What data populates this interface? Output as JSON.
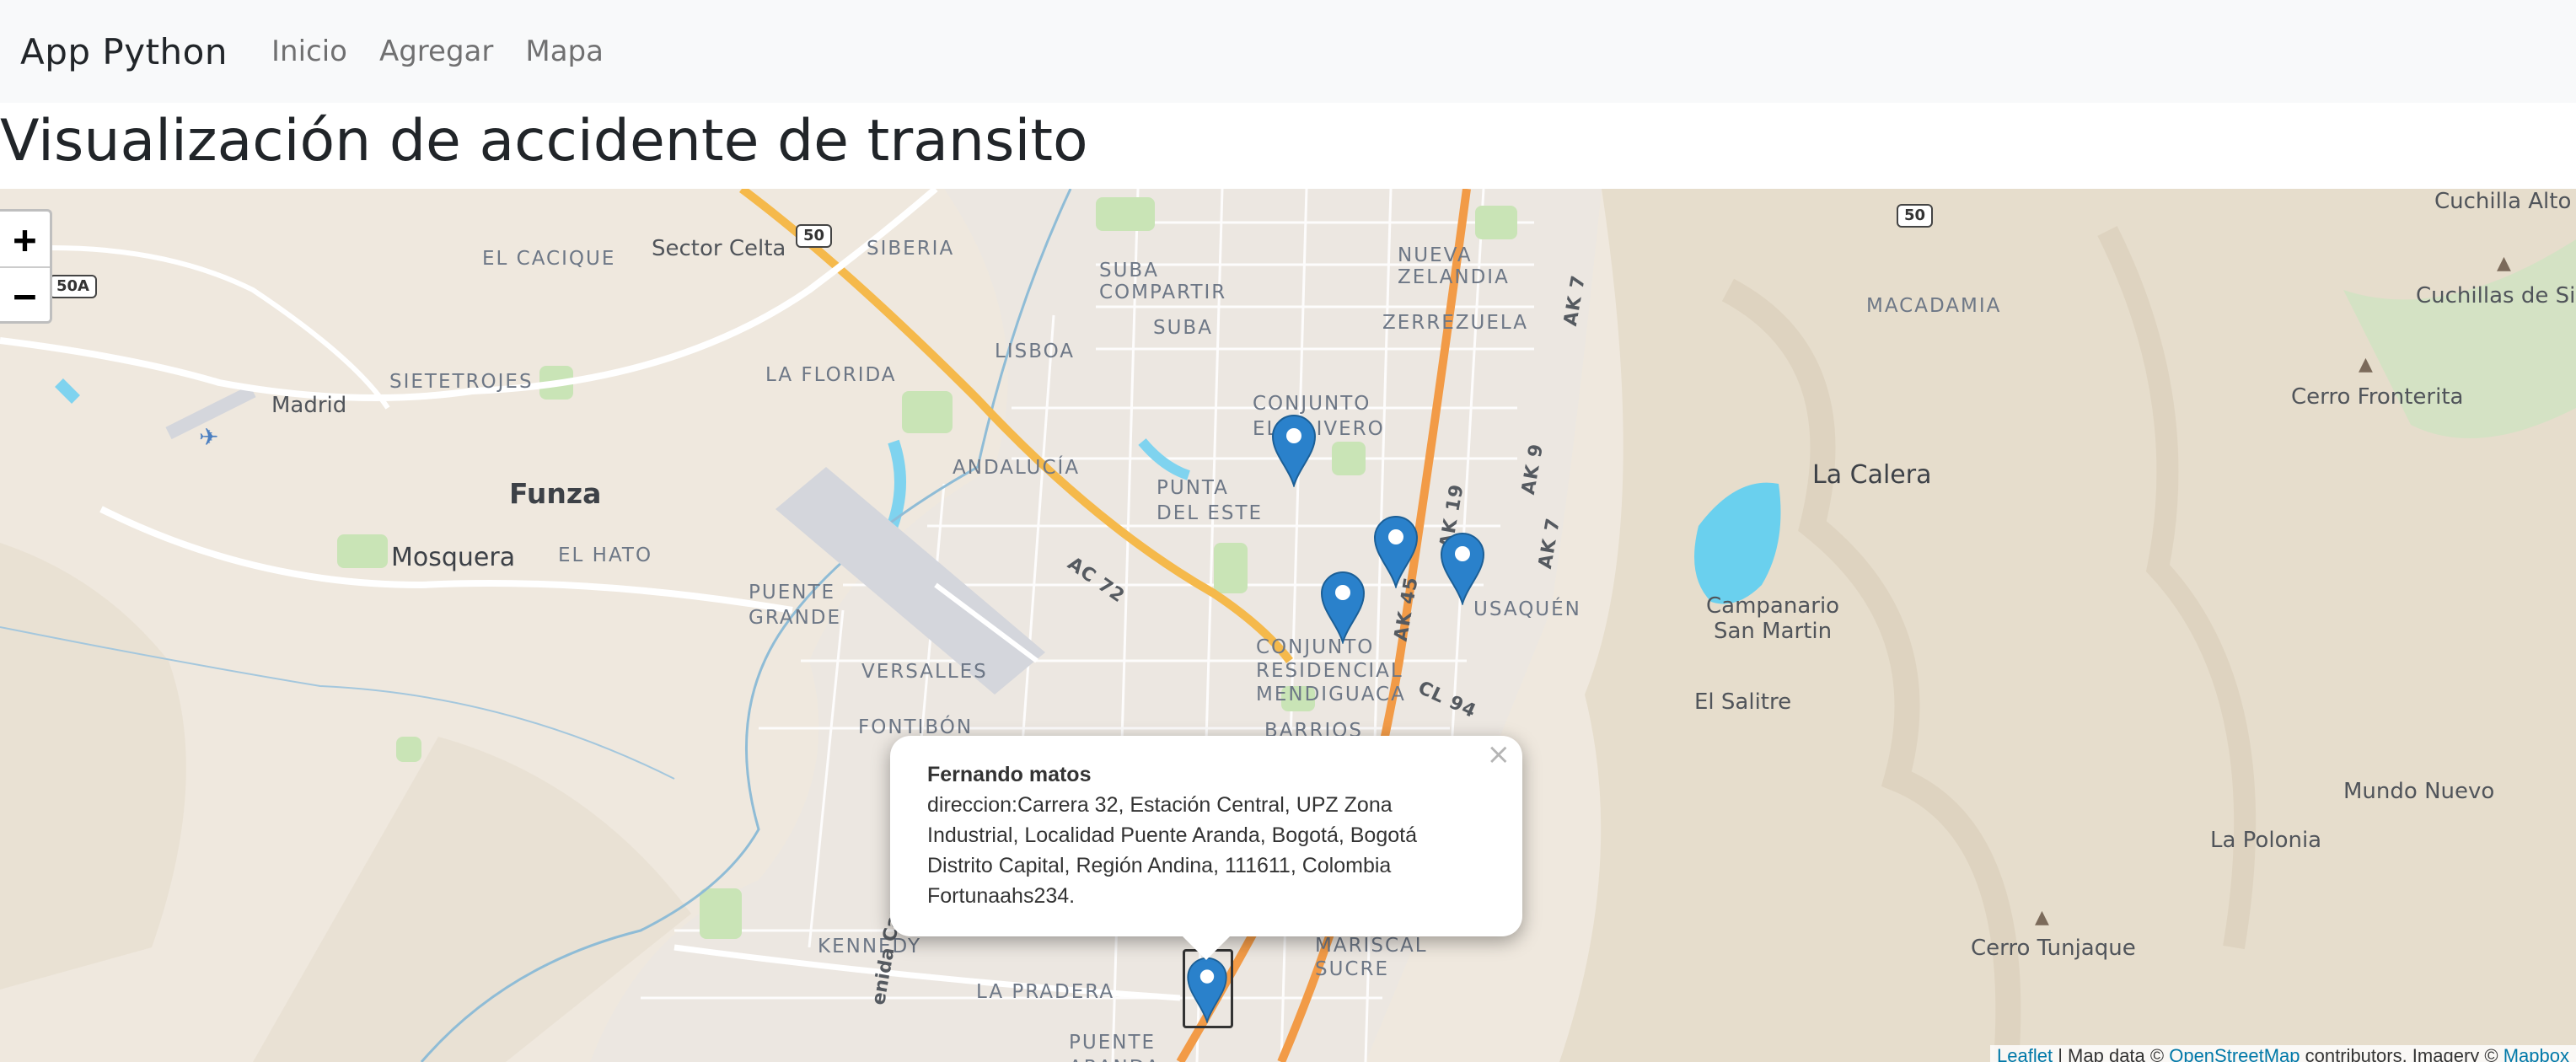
{
  "navbar": {
    "brand": "App Python",
    "links": [
      "Inicio",
      "Agregar",
      "Mapa"
    ]
  },
  "page": {
    "title": "Visualización de accidente de transito"
  },
  "map": {
    "zoom_in": "+",
    "zoom_out": "−",
    "labels": {
      "el_cacique": "EL CACIQUE",
      "sector_celta": "Sector Celta",
      "siberia": "SIBERIA",
      "suba_compartir": "SUBA\nCOMPARTIR",
      "nueva_zelandia": "NUEVA\nZELANDIA",
      "zerrezuela": "ZERREZUELA",
      "lisboa": "LISBOA",
      "suba": "SUBA",
      "la_florida": "LA FLORIDA",
      "madrid": "Madrid",
      "sietetrojes": "SIETETROJES",
      "funza": "Funza",
      "mosquera": "Mosquera",
      "el_hato": "EL HATO",
      "andalucia": "ANDALUCÍA",
      "punta_del_este": "PUNTA\nDEL ESTE",
      "conjunto_el_olivero": "CONJUNTO\nEL OLIVERO",
      "puente_grande": "PUENTE\nGRANDE",
      "versalles": "VERSALLES",
      "fontibon": "FONTIBÓN",
      "conjunto_residencial": "CONJUNTO\nRESIDENCIAL\nMENDIGUACA",
      "barrios": "BARRIOS",
      "usaquen": "USAQUÉN",
      "macadamia": "MACADAMIA",
      "la_calera": "La Calera",
      "campanario": "Campanario\nSan Martin",
      "el_salitre": "El Salitre",
      "cuchilla_alto": "Cuchilla Alto de",
      "cuchillas_sieco": "Cuchillas de Siec",
      "cerro_fronterita": "Cerro Fronterita",
      "mundo_nuevo": "Mundo Nuevo",
      "la_polonia": "La Polonia",
      "cerro_tunjaque": "Cerro Tunjaque",
      "kennedy": "KENNEDY",
      "la_pradera": "LA PRADERA",
      "puente_aranda": "PUENTE\nARANDA",
      "mariscal_sucre": "MARISCAL\nSUCRE",
      "avenida_carrera": "enida Carrera",
      "ac72": "AC 72",
      "ak45": "AK 45",
      "ak19": "AK 19",
      "ak9": "AK 9",
      "ak7": "AK 7",
      "ak7_top": "AK 7",
      "cl94": "CL 94",
      "road_50a": "50A",
      "road_50_left": "50",
      "road_50_right": "50"
    },
    "popup": {
      "name": "Fernando matos",
      "body": "direccion:Carrera 32, Estación Central, UPZ Zona Industrial, Localidad Puente Aranda, Bogotá, Bogotá Distrito Capital, Región Andina, 111611, Colombia Fortunaahs234.",
      "close": "×"
    },
    "attribution": {
      "leaflet": "Leaflet",
      "sep": " | Map data © ",
      "osm": "OpenStreetMap",
      "rest": " contributors, Imagery © ",
      "mapbox": "Mapbox"
    },
    "marker_color": "#2a81cb"
  }
}
